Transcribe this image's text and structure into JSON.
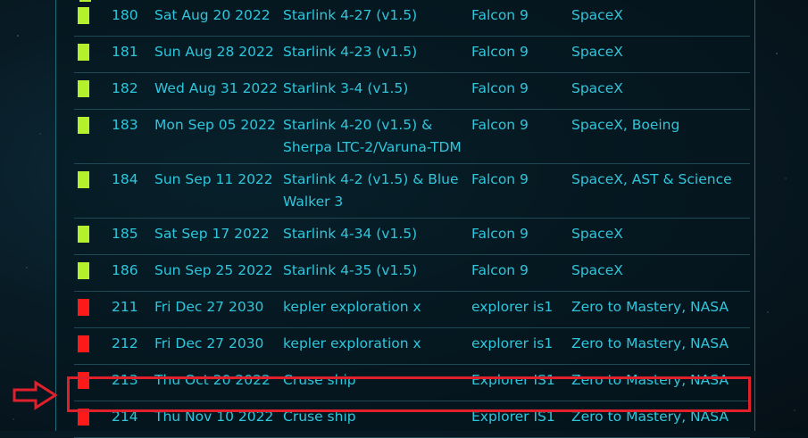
{
  "colors": {
    "success": "#b5f02c",
    "failure": "#ff1a1a",
    "text": "#2fc6dc",
    "highlight": "#e0202a"
  },
  "launches": [
    {
      "status": "success",
      "number": "180",
      "date": "Sat Aug 20 2022",
      "mission": "Starlink 4-27 (v1.5)",
      "rocket": "Falcon 9",
      "customers": "SpaceX"
    },
    {
      "status": "success",
      "number": "181",
      "date": "Sun Aug 28 2022",
      "mission": "Starlink 4-23 (v1.5)",
      "rocket": "Falcon 9",
      "customers": "SpaceX"
    },
    {
      "status": "success",
      "number": "182",
      "date": "Wed Aug 31 2022",
      "mission": "Starlink 3-4 (v1.5)",
      "rocket": "Falcon 9",
      "customers": "SpaceX"
    },
    {
      "status": "success",
      "number": "183",
      "date": "Mon Sep 05 2022",
      "mission": "Starlink 4-20 (v1.5) & Sherpa LTC-2/Varuna-TDM",
      "rocket": "Falcon 9",
      "customers": "SpaceX, Boeing"
    },
    {
      "status": "success",
      "number": "184",
      "date": "Sun Sep 11 2022",
      "mission": "Starlink 4-2 (v1.5) & Blue Walker 3",
      "rocket": "Falcon 9",
      "customers": "SpaceX, AST & Science"
    },
    {
      "status": "success",
      "number": "185",
      "date": "Sat Sep 17 2022",
      "mission": "Starlink 4-34 (v1.5)",
      "rocket": "Falcon 9",
      "customers": "SpaceX"
    },
    {
      "status": "success",
      "number": "186",
      "date": "Sun Sep 25 2022",
      "mission": "Starlink 4-35 (v1.5)",
      "rocket": "Falcon 9",
      "customers": "SpaceX"
    },
    {
      "status": "failure",
      "number": "211",
      "date": "Fri Dec 27 2030",
      "mission": "kepler exploration x",
      "rocket": "explorer is1",
      "customers": "Zero to Mastery, NASA"
    },
    {
      "status": "failure",
      "number": "212",
      "date": "Fri Dec 27 2030",
      "mission": "kepler exploration x",
      "rocket": "explorer is1",
      "customers": "Zero to Mastery, NASA"
    },
    {
      "status": "failure",
      "number": "213",
      "date": "Thu Oct 20 2022",
      "mission": "Cruse ship",
      "rocket": "Explorer IS1",
      "customers": "Zero to Mastery, NASA"
    },
    {
      "status": "failure",
      "number": "214",
      "date": "Thu Nov 10 2022",
      "mission": "Cruse ship",
      "rocket": "Explorer IS1",
      "customers": "Zero to Mastery, NASA"
    }
  ],
  "annotation": {
    "arrow_icon": "right-arrow-icon",
    "highlighted_row": "214"
  }
}
